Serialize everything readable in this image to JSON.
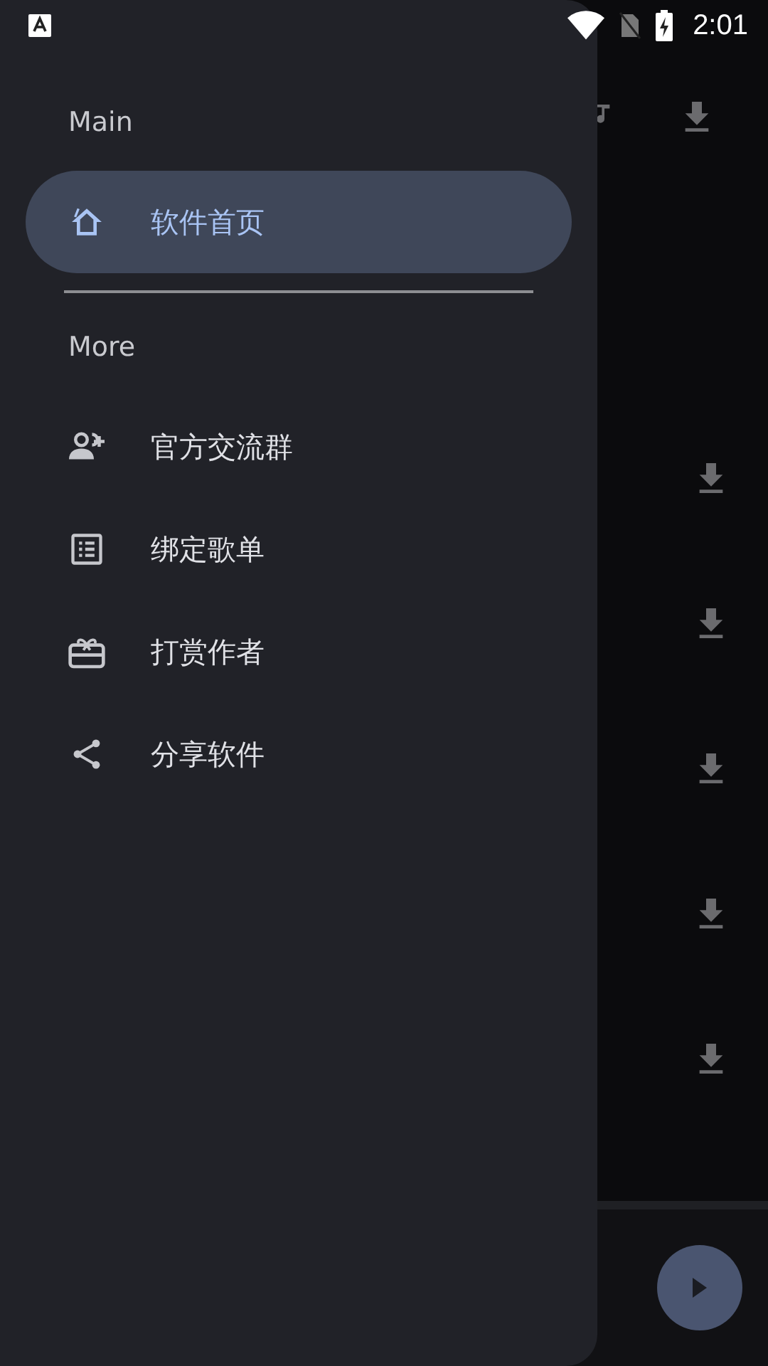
{
  "status_bar": {
    "time": "2:01"
  },
  "drawer": {
    "sections": [
      {
        "title": "Main",
        "items": [
          {
            "label": "软件首页",
            "kind": "home",
            "selected": true
          }
        ]
      },
      {
        "title": "More",
        "items": [
          {
            "label": "官方交流群",
            "kind": "group",
            "selected": false
          },
          {
            "label": "绑定歌单",
            "kind": "list",
            "selected": false
          },
          {
            "label": "打赏作者",
            "kind": "gift",
            "selected": false
          },
          {
            "label": "分享软件",
            "kind": "share",
            "selected": false
          }
        ]
      }
    ]
  }
}
